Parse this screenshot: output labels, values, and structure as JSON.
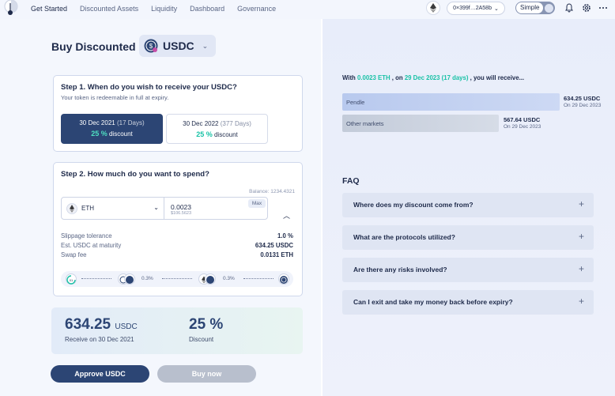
{
  "nav": {
    "links": [
      "Get Started",
      "Discounted Assets",
      "Liquidity",
      "Dashboard",
      "Governance"
    ],
    "wallet_address": "0×399f…2A58b",
    "mode_label": "Simple"
  },
  "buy": {
    "title": "Buy Discounted",
    "token": "USDC"
  },
  "step1": {
    "title": "Step 1. When do you wish to receive your USDC?",
    "subtitle": "Your token is redeemable in full at expiry.",
    "options": [
      {
        "date": "30 Dec 2021",
        "days": "(17 Days)",
        "discount_pct": "25 %",
        "discount_label": "discount",
        "selected": true
      },
      {
        "date": "30 Dec 2022",
        "days": "(377 Days)",
        "discount_pct": "25 %",
        "discount_label": "discount",
        "selected": false
      }
    ]
  },
  "step2": {
    "title": "Step 2. How much do you want to spend?",
    "balance": "Balance: 1234.4321",
    "asset": "ETH",
    "amount": "0.0023",
    "amount_usd": "$106.5623",
    "max_label": "Max",
    "details": [
      {
        "label": "Slippage tolerance",
        "value": "1.0 %"
      },
      {
        "label": "Est. USDC at maturity",
        "value": "634.25 USDC"
      },
      {
        "label": "Swap fee",
        "value": "0.0131 ETH"
      }
    ],
    "route": [
      "0.3%",
      "0.3%"
    ]
  },
  "result": {
    "amount": "634.25",
    "unit": "USDC",
    "receive_label": "Receive on 30 Dec 2021",
    "discount": "25 %",
    "discount_label": "Discount"
  },
  "actions": {
    "approve": "Approve USDC",
    "buy": "Buy now"
  },
  "compare": {
    "prefix": "With",
    "amount": "0.0023 ETH",
    "mid": ", on",
    "date": "29 Dec 2023 (17 days)",
    "suffix": ", you will receive...",
    "rows": [
      {
        "name": "Pendle",
        "value": "634.25 USDC",
        "sub": "On 29 Dec 2023"
      },
      {
        "name": "Other markets",
        "value": "567.64 USDC",
        "sub": "On 29 Dec 2023"
      }
    ]
  },
  "faq": {
    "title": "FAQ",
    "items": [
      "Where does my discount come from?",
      "What are the protocols utilized?",
      "Are there any risks involved?",
      "Can I exit and take my money back before expiry?"
    ]
  },
  "colors": {
    "primary": "#2c4574",
    "accent": "#19c2a6",
    "panel": "#f4f7fd"
  }
}
